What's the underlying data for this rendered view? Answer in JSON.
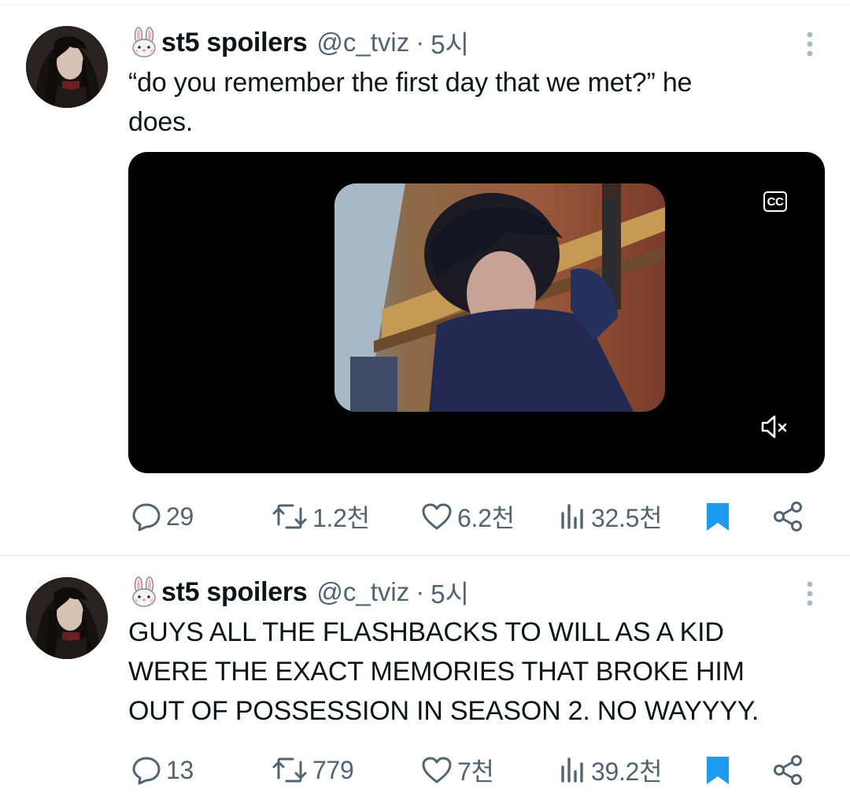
{
  "tweets": [
    {
      "author": {
        "name": "st5 spoilers",
        "handle": "@c_tviz",
        "emoji": "🐰"
      },
      "separator": "·",
      "time": "5시",
      "text_lines": [
        "“do you remember the first day that we met?” he",
        "does."
      ],
      "media": {
        "type": "video",
        "cc_label": "CC",
        "muted": true
      },
      "stats": {
        "replies": "29",
        "reposts": "1.2천",
        "likes": "6.2천",
        "views": "32.5천"
      }
    },
    {
      "author": {
        "name": "st5 spoilers",
        "handle": "@c_tviz",
        "emoji": "🐰"
      },
      "separator": "·",
      "time": "5시",
      "text_lines": [
        "GUYS ALL THE FLASHBACKS TO WILL AS A KID",
        "WERE THE EXACT MEMORIES THAT BROKE HIM",
        "OUT OF POSSESSION IN SEASON 2. NO WAYYYY."
      ],
      "stats": {
        "replies": "13",
        "reposts": "779",
        "likes": "7천",
        "views": "39.2천"
      }
    }
  ],
  "colors": {
    "text": "#0f1419",
    "secondary": "#536471",
    "bookmark_active": "#1d9bf0",
    "divider": "#e1e8ed"
  }
}
